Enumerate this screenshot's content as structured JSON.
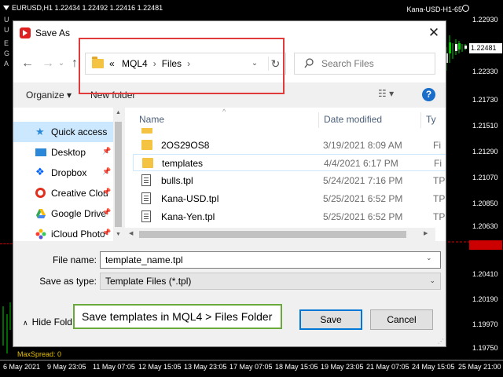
{
  "chart": {
    "symbol_title": "EURUSD,H1  1.22434 1.22492 1.22416 1.22481",
    "indicator_label": "Kana-USD-H1-65",
    "left_letters": [
      "U",
      "U",
      "E",
      "G",
      "A"
    ],
    "current_price": "1.22481",
    "price_labels": [
      "1.22930",
      "1.22330",
      "1.21730",
      "1.21510",
      "1.21290",
      "1.21070",
      "1.20850",
      "1.20630",
      "1.20410",
      "1.20190",
      "1.19970",
      "1.19750"
    ],
    "time_labels": [
      "6 May 2021",
      "9 May 23:05",
      "11 May 07:05",
      "12 May 15:05",
      "13 May 23:05",
      "17 May 07:05",
      "18 May 15:05",
      "19 May 23:05",
      "21 May 07:05",
      "24 May 15:05",
      "25 May 21:00"
    ],
    "max_spread": "MaxSpread: 0",
    "colors": {
      "background": "#000000",
      "bull": "#00d000",
      "bear": "#ffffff"
    }
  },
  "dialog": {
    "title": "Save As",
    "app_icon": "red-app-icon",
    "close_icon": "close-icon",
    "nav": {
      "back_icon": "back-arrow-icon",
      "forward_icon": "forward-arrow-icon",
      "recent_icon": "chevron-down-icon",
      "up_icon": "up-arrow-icon"
    },
    "address": {
      "overflow": "«",
      "crumbs": [
        "MQL4",
        "Files"
      ],
      "refresh_icon": "refresh-icon"
    },
    "search": {
      "placeholder": "Search Files"
    },
    "toolbar": {
      "organize": "Organize ▾",
      "new_folder": "New folder",
      "help": "?"
    },
    "nav_pane": [
      {
        "label": "Quick access",
        "icon": "star-icon",
        "selected": true,
        "pinned": false
      },
      {
        "label": "Desktop",
        "icon": "desktop-icon",
        "selected": false,
        "pinned": true
      },
      {
        "label": "Dropbox",
        "icon": "dropbox-icon",
        "selected": false,
        "pinned": true
      },
      {
        "label": "Creative Clou",
        "icon": "creative-cloud-icon",
        "selected": false,
        "pinned": true
      },
      {
        "label": "Google Drive",
        "icon": "google-drive-icon",
        "selected": false,
        "pinned": true
      },
      {
        "label": "iCloud Photo",
        "icon": "icloud-icon",
        "selected": false,
        "pinned": true
      }
    ],
    "columns": {
      "name": "Name",
      "date": "Date modified",
      "type": "Ty"
    },
    "files": [
      {
        "name": "2OS29OS8",
        "date": "3/19/2021 8:09 AM",
        "type": "Fi",
        "kind": "folder"
      },
      {
        "name": "templates",
        "date": "4/4/2021 6:17 PM",
        "type": "Fi",
        "kind": "folder"
      },
      {
        "name": "bulls.tpl",
        "date": "5/24/2021 7:16 PM",
        "type": "TP",
        "kind": "file"
      },
      {
        "name": "Kana-USD.tpl",
        "date": "5/25/2021 6:52 PM",
        "type": "TP",
        "kind": "file"
      },
      {
        "name": "Kana-Yen.tpl",
        "date": "5/25/2021 6:52 PM",
        "type": "TP",
        "kind": "file"
      }
    ],
    "file_name_label": "File name:",
    "file_name_value": "template_name.tpl",
    "save_type_label": "Save as type:",
    "save_type_value": "Template Files (*.tpl)",
    "hide_folders": "Hide Fold",
    "callout": "Save templates in MQL4 > Files Folder",
    "save": "Save",
    "cancel": "Cancel",
    "colors": {
      "annotation_red": "#e03a3a",
      "annotation_green": "#6aaa3a",
      "selection": "#cce8ff",
      "folder": "#f5c342"
    }
  }
}
